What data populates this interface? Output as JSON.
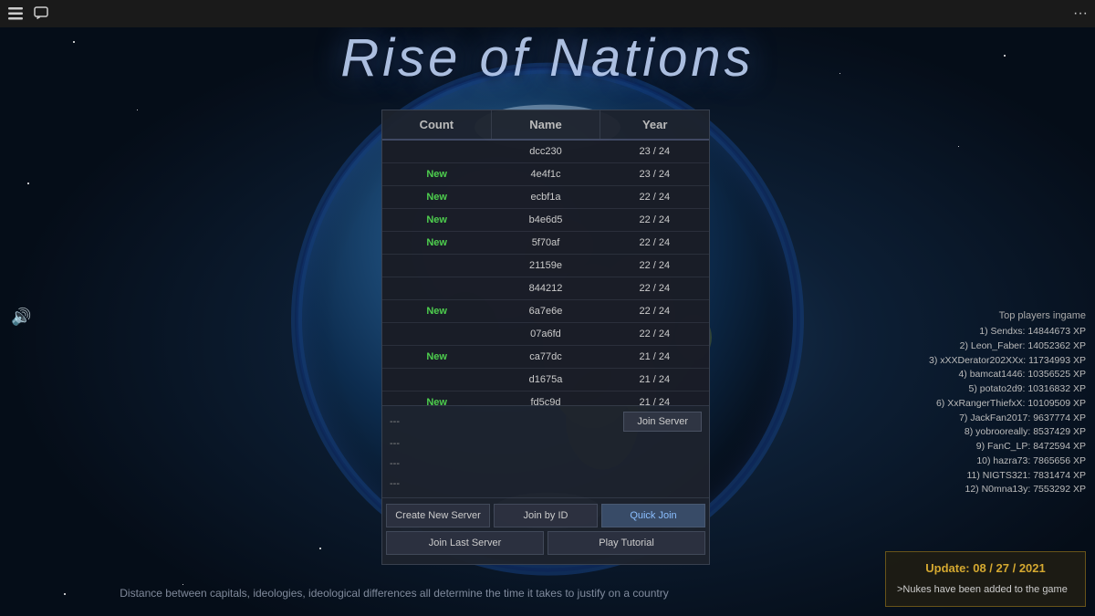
{
  "app": {
    "title": "Rise of Nations"
  },
  "topbar": {
    "menu_icon": "☰",
    "chat_icon": "💬",
    "more_icon": "···"
  },
  "table": {
    "headers": [
      "Count",
      "Name",
      "Year"
    ],
    "rows": [
      {
        "count": "",
        "name": "dcc230",
        "year": "23 / 24",
        "new": false
      },
      {
        "count": "New",
        "name": "4e4f1c",
        "year": "23 / 24",
        "new": true
      },
      {
        "count": "New",
        "name": "ecbf1a",
        "year": "22 / 24",
        "new": true
      },
      {
        "count": "New",
        "name": "b4e6d5",
        "year": "22 / 24",
        "new": true
      },
      {
        "count": "New",
        "name": "5f70af",
        "year": "22 / 24",
        "new": true
      },
      {
        "count": "",
        "name": "21159e",
        "year": "22 / 24",
        "new": false
      },
      {
        "count": "",
        "name": "844212",
        "year": "22 / 24",
        "new": false
      },
      {
        "count": "New",
        "name": "6a7e6e",
        "year": "22 / 24",
        "new": true
      },
      {
        "count": "",
        "name": "07a6fd",
        "year": "22 / 24",
        "new": false
      },
      {
        "count": "New",
        "name": "ca77dc",
        "year": "21 / 24",
        "new": true
      },
      {
        "count": "",
        "name": "d1675a",
        "year": "21 / 24",
        "new": false
      },
      {
        "count": "New",
        "name": "fd5c9d",
        "year": "21 / 24",
        "new": true
      }
    ]
  },
  "panel_rows": [
    {
      "text": "---"
    },
    {
      "text": "---"
    },
    {
      "text": "---"
    },
    {
      "text": "---"
    }
  ],
  "buttons": {
    "join_server": "Join Server",
    "create_new": "Create New Server",
    "join_by_id": "Join by ID",
    "quick_join": "Quick Join",
    "join_last": "Join Last Server",
    "play_tutorial": "Play Tutorial"
  },
  "top_players": {
    "title": "Top players ingame",
    "entries": [
      "1) Sendxs: 14844673 XP",
      "2) Leon_Faber: 14052362 XP",
      "3) xXXDerator202XXx: 11734993 XP",
      "4) bamcat1446: 10356525 XP",
      "5) potato2d9: 10316832 XP",
      "6) XxRangerThiefxX: 10109509 XP",
      "7) JackFan2017: 9637774 XP",
      "8) yobrooreally: 8537429 XP",
      "9) FanC_LP: 8472594 XP",
      "10) hazra73: 7865656 XP",
      "11) NIGTS321: 7831474 XP",
      "12) N0mna13y: 7553292 XP"
    ]
  },
  "update": {
    "title": "Update: 08 / 27 / 2021",
    "text": ">Nukes have been added to the game"
  },
  "footer": {
    "text": "Distance between capitals, ideologies, ideological differences all determine the time it takes to justify on a country"
  },
  "sound": {
    "icon": "🔊"
  }
}
